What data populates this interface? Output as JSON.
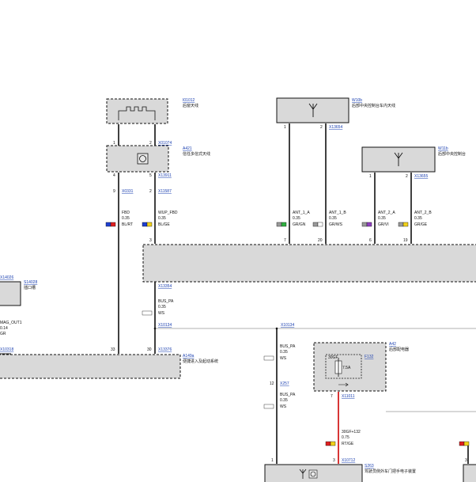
{
  "components": {
    "ant_rear_window": {
      "ref": "I01012",
      "desc": "后窗天线"
    },
    "amp_a421": {
      "ref": "A421",
      "desc": "信任多信式天线"
    },
    "ant_w10b": {
      "ref": "W10b",
      "desc": "后部中央控制台车内天线"
    },
    "ant_w11b": {
      "ref": "W11b",
      "desc": "后部中央控制台"
    },
    "s14028": {
      "ref": "S14028",
      "desc": "插口槽"
    },
    "ecu_a149a": {
      "ref": "A149a",
      "desc": "便捷进入及起动系统"
    },
    "fusebox_a42": {
      "ref": "A42",
      "desc": "后部配电器"
    },
    "fuse_f132": {
      "ref": "F132",
      "rating": "7.5A",
      "label": "30GF"
    },
    "door_s263": {
      "ref": "S263",
      "desc": "驾驶员侧外车门把手电子装置"
    }
  },
  "connectors": [
    "X01074",
    "X13911",
    "X0331",
    "X11587",
    "X13654",
    "X13655",
    "X13354",
    "X10134",
    "X10134",
    "X13376",
    "X10318",
    "X14026",
    "X257",
    "X11011",
    "X10712"
  ],
  "wires": [
    {
      "signal": "FBD",
      "size": "0.35",
      "color": "BL/RT"
    },
    {
      "signal": "WUP_FBD",
      "size": "0.35",
      "color": "BL/GE"
    },
    {
      "signal": "ANT_1_A",
      "size": "0.35",
      "color": "GR/GN"
    },
    {
      "signal": "ANT_1_B",
      "size": "0.35",
      "color": "GR/WS"
    },
    {
      "signal": "ANT_2_A",
      "size": "0.35",
      "color": "GR/VI"
    },
    {
      "signal": "ANT_2_B",
      "size": "0.35",
      "color": "GR/GE"
    },
    {
      "signal": "BUS_PA",
      "size": "0.35",
      "color": "WS"
    },
    {
      "signal": "BUS_PA",
      "size": "0.35",
      "color": "WS"
    },
    {
      "signal": "BUS_PA",
      "size": "0.35",
      "color": "WS"
    },
    {
      "signal": "MAG_OUT1",
      "size": "0.14",
      "color": "GR"
    },
    {
      "signal": "30GF+132",
      "size": "0.75",
      "color": "RT/GE"
    }
  ],
  "pins": [
    "1",
    "2",
    "4",
    "5",
    "9",
    "2",
    "1",
    "2",
    "1",
    "2",
    "7",
    "20",
    "6",
    "19",
    "3",
    "33",
    "30",
    "12",
    "7",
    "3",
    "1",
    "3",
    "3"
  ],
  "colors": {
    "wire": "#111111",
    "box_fill": "#d9d9d9",
    "link": "#1a3fb0",
    "power_wire": "#d42020"
  }
}
